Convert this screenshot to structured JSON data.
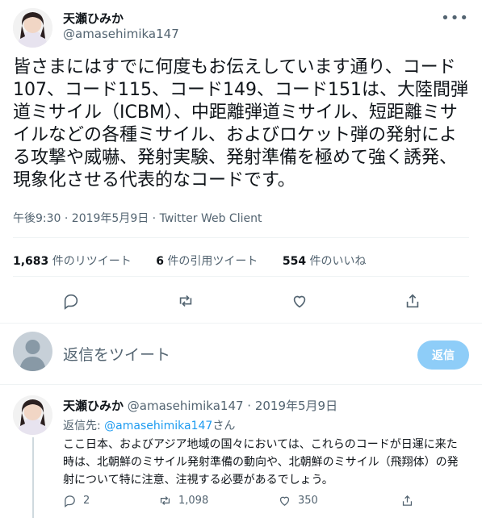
{
  "tweet": {
    "display_name": "天瀬ひみか",
    "handle": "@amasehimika147",
    "text": "皆さまにはすでに何度もお伝えしています通り、コード107、コード115、コード149、コード151は、大陸間弾道ミサイル（ICBM）、中距離弾道ミサイル、短距離ミサイルなどの各種ミサイル、およびロケット弾の発射による攻撃や威嚇、発射実験、発射準備を極めて強く誘発、現象化させる代表的なコードです。",
    "timestamp": "午後9:30 · 2019年5月9日 · Twitter Web Client",
    "stats": {
      "retweets_count": "1,683",
      "retweets_label": "件のリツイート",
      "quotes_count": "6",
      "quotes_label": "件の引用ツイート",
      "likes_count": "554",
      "likes_label": "件のいいね"
    }
  },
  "composer": {
    "placeholder": "返信をツイート",
    "button_label": "返信"
  },
  "reply": {
    "display_name": "天瀬ひみか",
    "handle_date": "@amasehimika147 · 2019年5月9日",
    "reply_to_prefix": "返信先: ",
    "reply_to_handle": "@amasehimika147",
    "reply_to_suffix": "さん",
    "text": "ここ日本、およびアジア地域の国々においては、これらのコードが日運に来た時は、北朝鮮のミサイル発射準備の動向や、北朝鮮のミサイル（飛翔体）の発射について特に注意、注視する必要があるでしょう。",
    "replies": "2",
    "retweets": "1,098",
    "likes": "350"
  },
  "icons": {
    "more": "more-icon",
    "reply": "reply-icon",
    "retweet": "retweet-icon",
    "like": "like-icon",
    "share": "share-icon"
  },
  "colors": {
    "accent": "#1d9bf0",
    "button_disabled": "#8ecdf8",
    "muted": "#536471"
  }
}
